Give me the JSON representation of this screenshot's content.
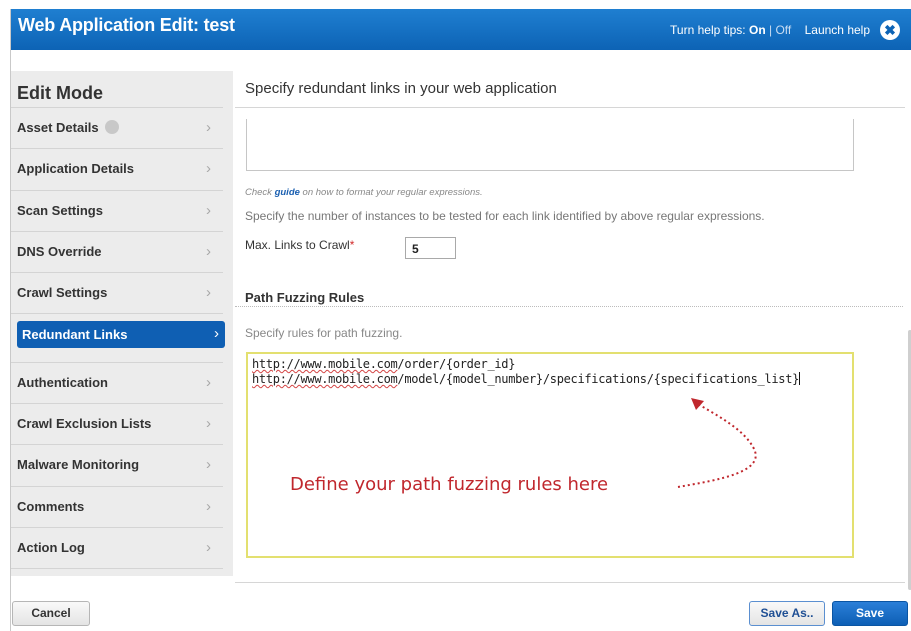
{
  "window": {
    "title": "Web Application Edit: test",
    "help": {
      "prefix": "Turn help tips:",
      "on": "On",
      "sep": "|",
      "off": "Off",
      "launch": "Launch help"
    },
    "close_glyph": "✖"
  },
  "sidebar": {
    "heading": "Edit Mode",
    "items": [
      {
        "label": "Asset Details",
        "icon": "gear-icon",
        "active": false
      },
      {
        "label": "Application Details",
        "active": false
      },
      {
        "label": "Scan Settings",
        "active": false
      },
      {
        "label": "DNS Override",
        "active": false
      },
      {
        "label": "Crawl Settings",
        "active": false
      },
      {
        "label": "Redundant Links",
        "active": true
      },
      {
        "label": "Authentication",
        "active": false
      },
      {
        "label": "Crawl Exclusion Lists",
        "active": false
      },
      {
        "label": "Malware Monitoring",
        "active": false
      },
      {
        "label": "Comments",
        "active": false
      },
      {
        "label": "Action Log",
        "active": false
      }
    ],
    "chevron": "›"
  },
  "main": {
    "heading": "Specify redundant links in your web application",
    "hint_before": "Check ",
    "hint_link": "guide",
    "hint_after": " on how to format your regular expressions.",
    "instances_text": "Specify the number of instances to be tested for each link identified by above regular expressions.",
    "max_links_label": "Max. Links to Crawl",
    "required_mark": "*",
    "max_links_value": "5",
    "section_title": "Path Fuzzing Rules",
    "section_desc": "Specify rules for path fuzzing.",
    "fuzz_lines": [
      {
        "url": "http://www.mobile.com",
        "rest": "/order/{order_id}"
      },
      {
        "url": "http://www.mobile.com",
        "rest": "/model/{model_number}/specifications/{specifications_list}"
      }
    ],
    "annotation": "Define your path fuzzing rules here"
  },
  "footer": {
    "cancel": "Cancel",
    "save_as": "Save As..",
    "save": "Save"
  },
  "colors": {
    "titlebar": "#0d63b5",
    "active_item": "#0f5fb3",
    "annotation": "#c0272d",
    "textarea_border": "#e3e070"
  }
}
